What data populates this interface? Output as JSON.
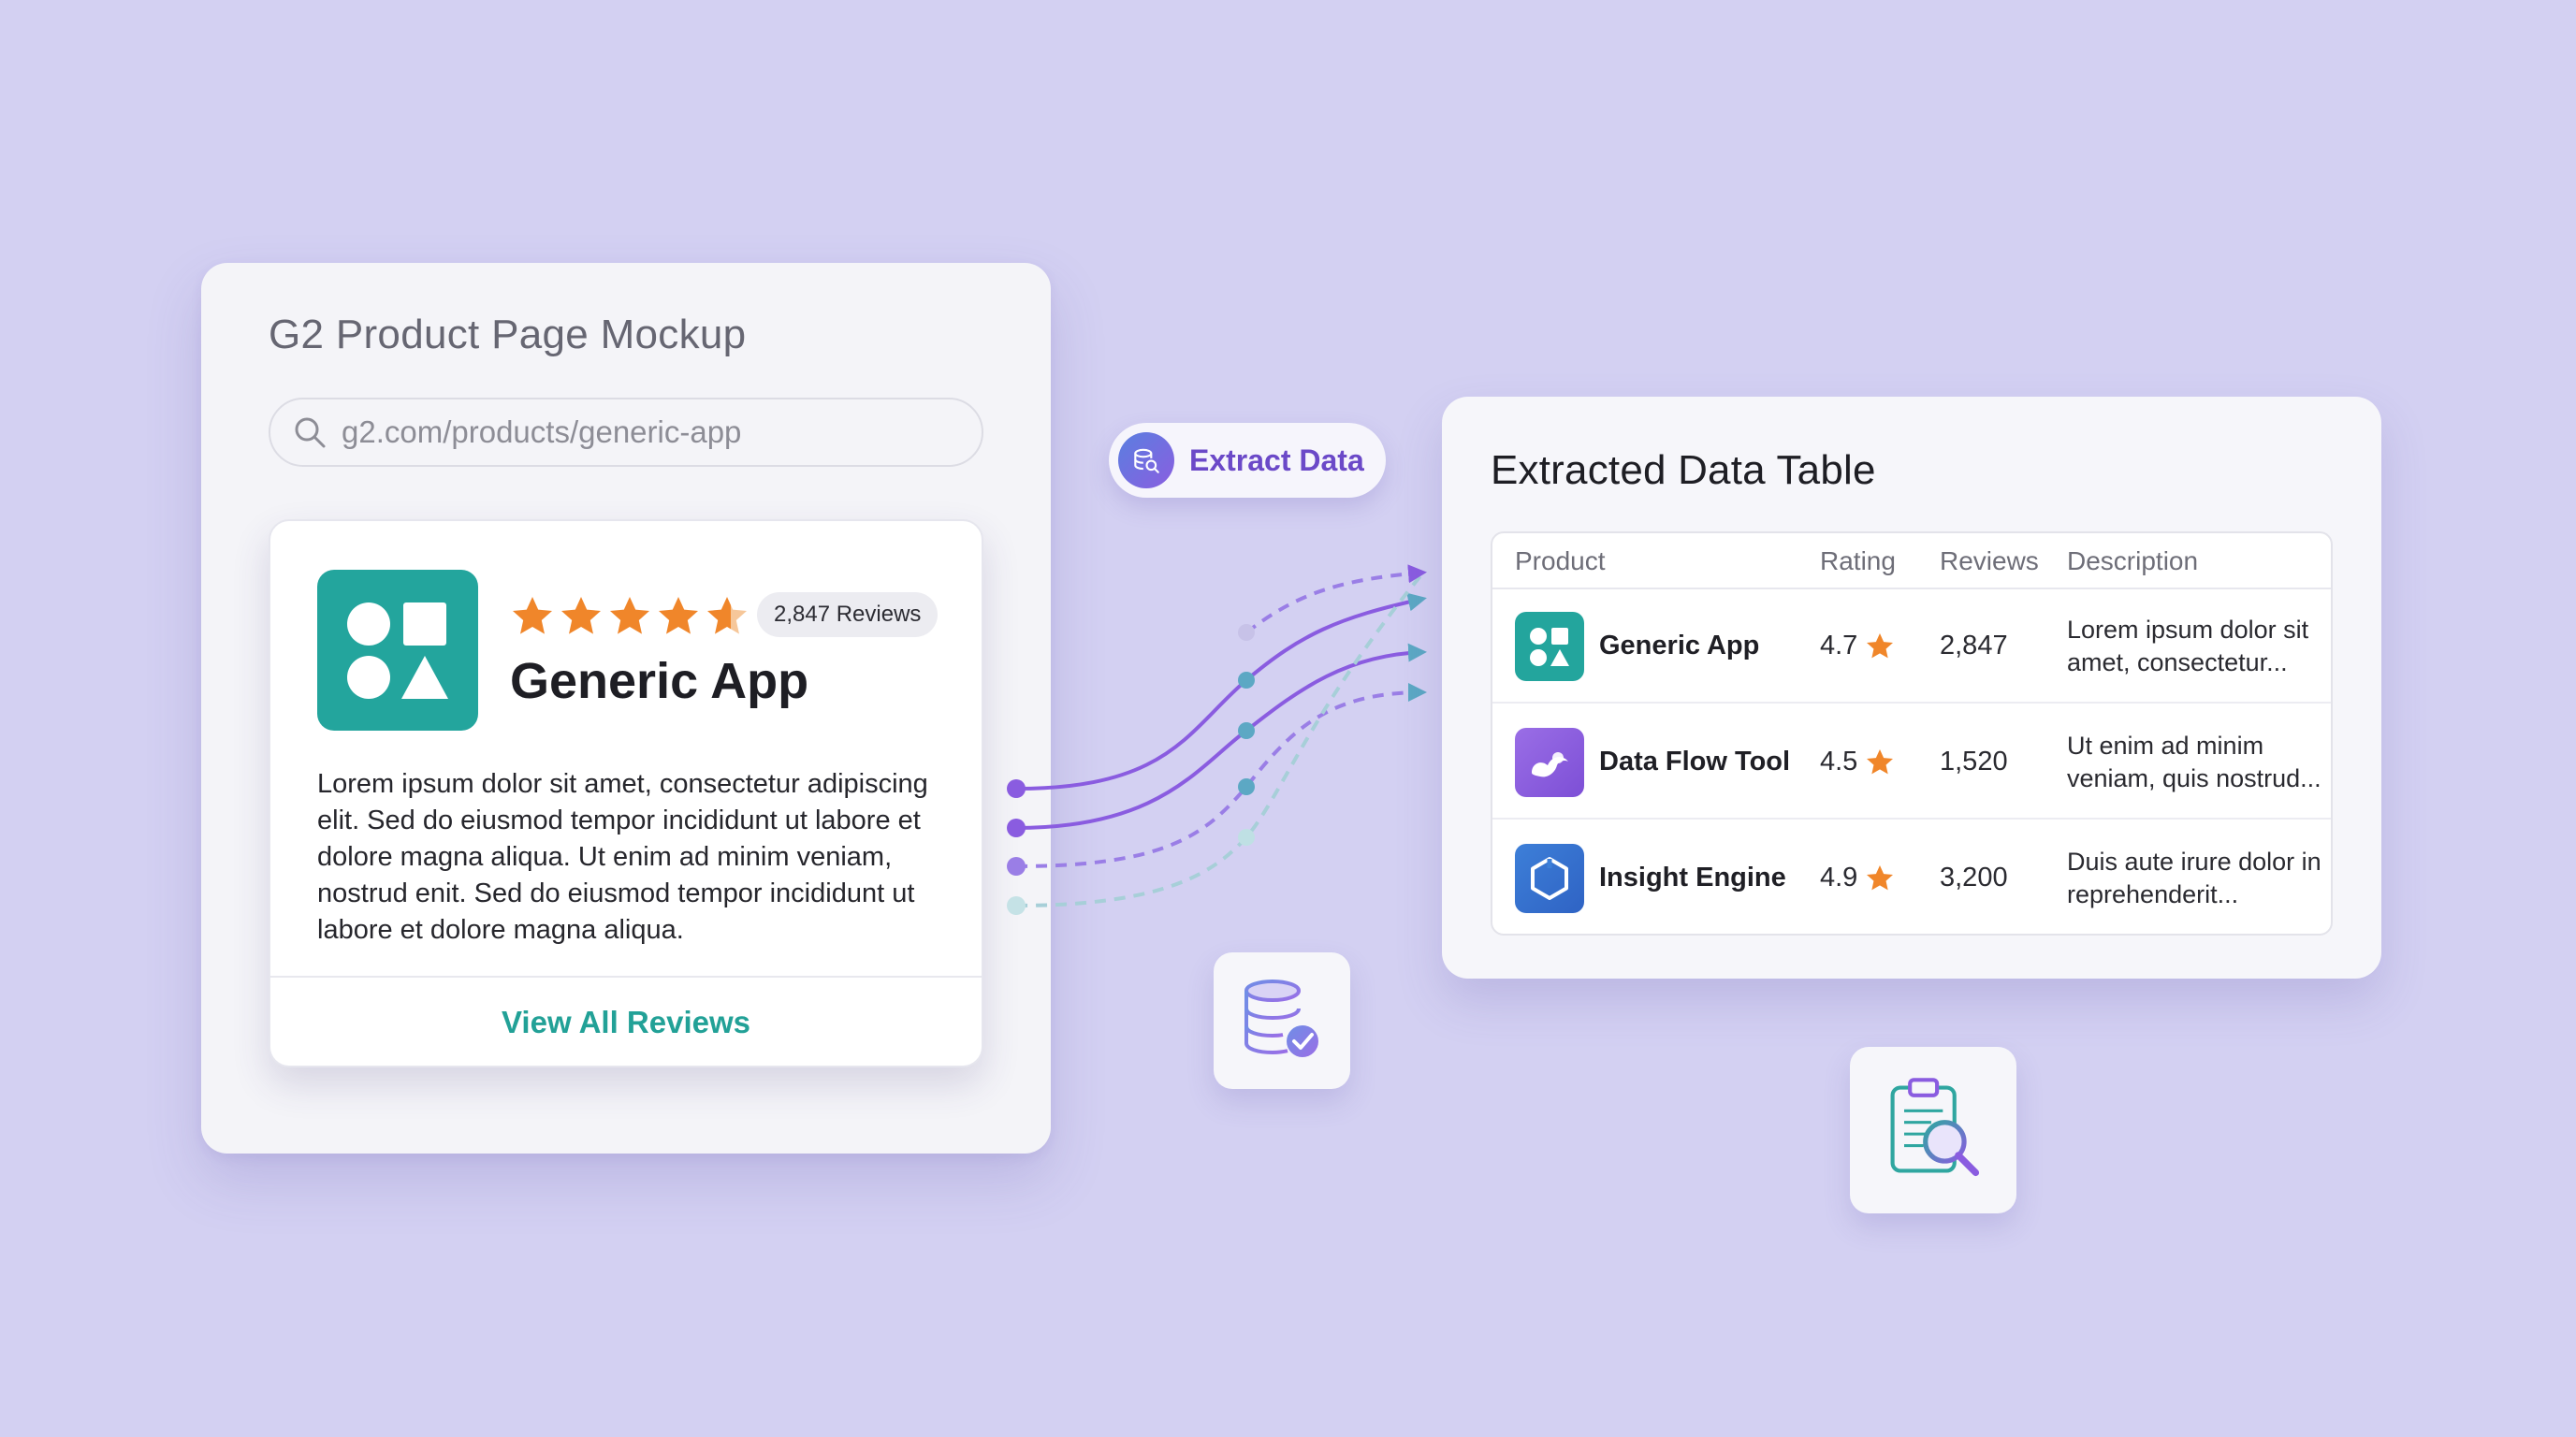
{
  "mockup": {
    "title": "G2 Product Page Mockup",
    "url": "g2.com/products/generic-app",
    "product": {
      "name": "Generic App",
      "rating": 4.7,
      "reviews_badge": "2,847 Reviews",
      "description": "Lorem ipsum dolor sit amet, consectetur adipiscing elit. Sed do eiusmod tempor incididunt ut labore et dolore magna aliqua. Ut enim ad minim veniam, nostrud enit. Sed do eiusmod tempor incididunt ut labore et dolore magna aliqua.",
      "view_all": "View All Reviews"
    }
  },
  "extract": {
    "label": "Extract Data"
  },
  "table": {
    "title": "Extracted Data Table",
    "columns": [
      "Product",
      "Rating",
      "Reviews",
      "Description"
    ],
    "rows": [
      {
        "product": "Generic App",
        "rating": "4.7",
        "reviews": "2,847",
        "description": "Lorem ipsum dolor sit amet, consectetur...",
        "icon": "shapes-icon",
        "color": "#23a59d"
      },
      {
        "product": "Data Flow Tool",
        "rating": "4.5",
        "reviews": "1,520",
        "description": "Ut enim ad minim veniam, quis nostrud...",
        "icon": "flow-icon",
        "color": "#8a5ce0"
      },
      {
        "product": "Insight Engine",
        "rating": "4.9",
        "reviews": "3,200",
        "description": "Duis aute irure dolor in reprehenderit...",
        "icon": "hexagon-icon",
        "color": "#3d7fd8"
      }
    ]
  },
  "colors": {
    "background": "#d3d0f2",
    "teal": "#23a59d",
    "purple": "#6b49c8",
    "star": "#f0862a"
  }
}
